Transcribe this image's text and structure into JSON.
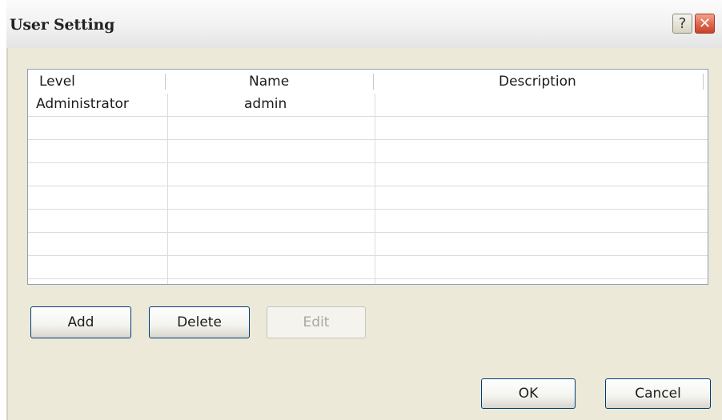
{
  "window": {
    "title": "User Setting",
    "help_label": "?",
    "close_label": "✕"
  },
  "table": {
    "columns": [
      "Level",
      "Name",
      "Description"
    ],
    "rows": [
      {
        "level": "Administrator",
        "name": "admin",
        "description": ""
      }
    ],
    "empty_row_count": 7
  },
  "actions": {
    "add_label": "Add",
    "delete_label": "Delete",
    "edit_label": "Edit",
    "edit_enabled": false
  },
  "footer": {
    "ok_label": "OK",
    "cancel_label": "Cancel"
  },
  "colors": {
    "window_bg": "#ece9d8",
    "button_border": "#003c74",
    "close_button": "#e06a4f"
  }
}
